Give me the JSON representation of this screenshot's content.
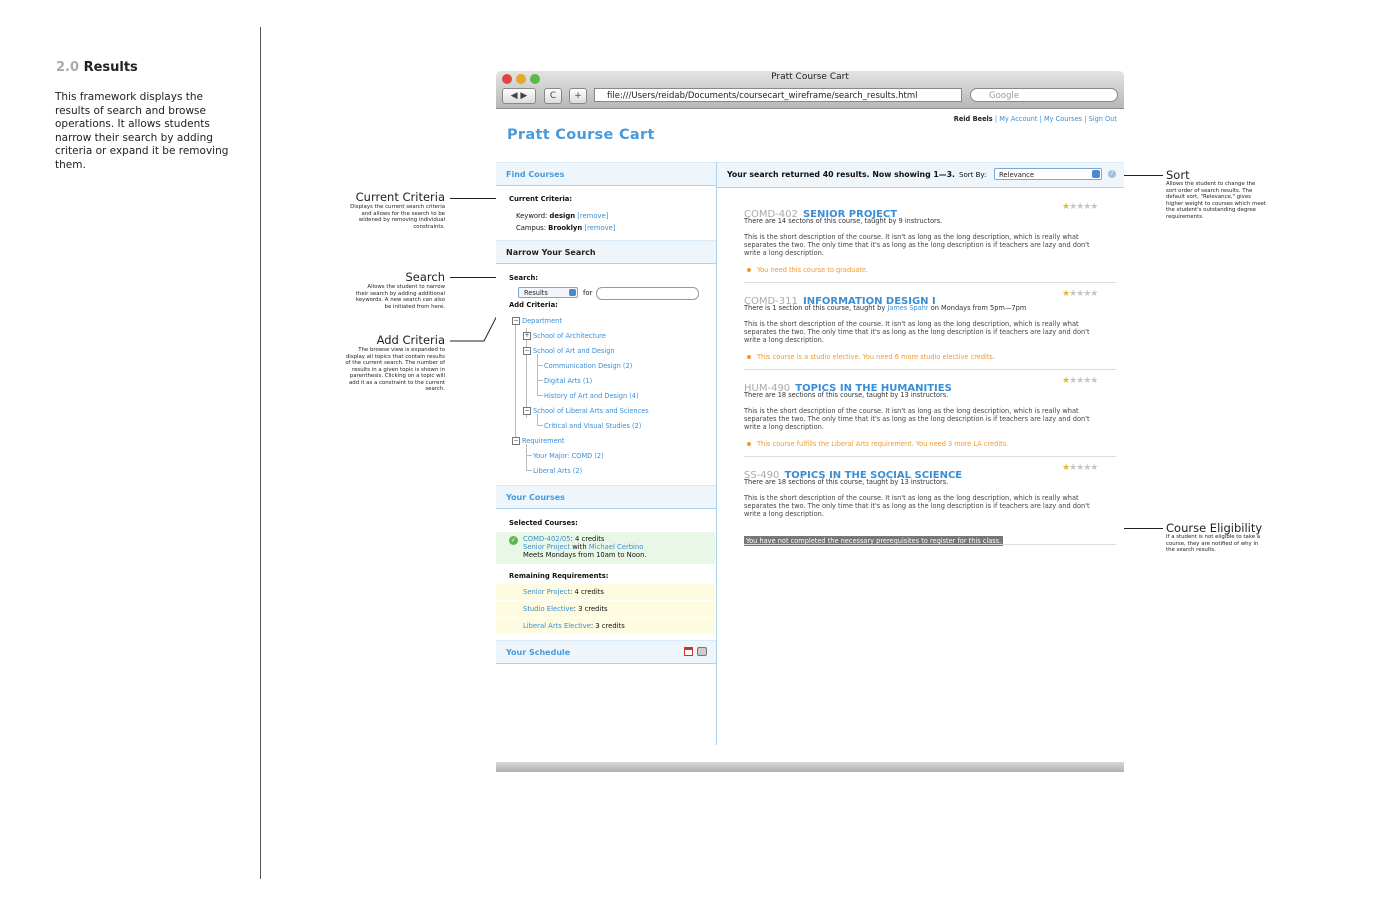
{
  "doc": {
    "section_number": "2.0",
    "section_title": "Results",
    "description": "This framework displays the results of search and browse operations. It allows students narrow their search by adding criteria or expand it be removing them."
  },
  "annotations": {
    "current_criteria": {
      "title": "Current Criteria",
      "body": "Displays the current search criteria and allows for the search to be widened by removing individual constraints."
    },
    "search": {
      "title": "Search",
      "body": "Allows the student to narrow their search by adding additional keywords. A new search can also be initiated from here."
    },
    "add_criteria": {
      "title": "Add Criteria",
      "body": "The browse view is expanded to display all topics that contain results of the current search. The number of results in a given topic is shown in parenthesis. Clicking on a topic will add it as a constraint to the current search."
    },
    "sort": {
      "title": "Sort",
      "body": "Allows the student to change the sort order of search results. The default sort, \"Relevance,\" gives higher weight to courses which meet the student's outstanding degree requirements."
    },
    "eligibility": {
      "title": "Course Eligibility",
      "body": "If a student is not eligible to take a course, they are notified of why in the search results."
    }
  },
  "browser": {
    "window_title": "Pratt Course Cart",
    "url": "file:///Users/reidab/Documents/coursecart_wireframe/search_results.html",
    "search_placeholder": "Google",
    "back_label": "◀ ▶",
    "reload_label": "C",
    "add_label": "+"
  },
  "app": {
    "brand": "Pratt Course Cart",
    "user_name": "Reid Beels",
    "links": {
      "my_account": "My Account",
      "my_courses": "My Courses",
      "sign_out": "Sign Out"
    },
    "separator": "|"
  },
  "sidebar": {
    "find_courses": "Find Courses",
    "current_criteria_label": "Current Criteria:",
    "criteria": [
      {
        "label": "Keyword:",
        "value": "design",
        "remove": "[remove]"
      },
      {
        "label": "Campus:",
        "value": "Brooklyn",
        "remove": "[remove]"
      }
    ],
    "narrow_head": "Narrow Your Search",
    "search_label": "Search:",
    "search_scope": "Results",
    "search_for": "for",
    "add_criteria_label": "Add Criteria:",
    "tree": {
      "department": "Department",
      "architecture": "School of Architecture",
      "art_design": "School of Art and Design",
      "comm_design": "Communication Design (2)",
      "digital_arts": "Digital Arts (1)",
      "history": "History of Art and Design (4)",
      "liberal_arts": "School of Liberal Arts and Sciences",
      "critical": "Critical and Visual Studies (2)",
      "requirement": "Requirement",
      "your_major": "Your Major: COMD (2)",
      "lib_arts_req": "Liberal Arts (2)"
    },
    "your_courses": "Your Courses",
    "selected_label": "Selected Courses:",
    "selected": {
      "code": "COMD-402/05",
      "credits": ": 4 credits",
      "title": "Senior Project",
      "with": "with",
      "instructor": "Michael Cerbino",
      "meets": "Meets Mondays from 10am to Noon."
    },
    "remaining_label": "Remaining Requirements:",
    "remaining": [
      {
        "name": "Senior Project",
        "credits": ": 4 credits"
      },
      {
        "name": "Studio Elective",
        "credits": ": 3 credits"
      },
      {
        "name": "Liberal Arts Elective",
        "credits": ": 3 credits"
      }
    ],
    "your_schedule": "Your Schedule"
  },
  "results": {
    "summary": "Your search returned 40 results. Now showing 1—3.",
    "sort_label": "Sort By:",
    "sort_value": "Relevance",
    "help": "?",
    "courses": [
      {
        "code": "COMD-402",
        "title": "SENIOR PROJECT",
        "meta": "There are 14 sectons of this course, taught by 9 instructors.",
        "desc": "This is the short description of the course. It isn't as long as the long description, which is really what separates the two. The only time that it's as long as the long description is if teachers are lazy and don't write a long description.",
        "note": "You need this course to graduate.",
        "rating": 1
      },
      {
        "code": "COMD-311",
        "title": "INFORMATION DESIGN I",
        "meta_pre": "There is 1 section of this course, taught by ",
        "meta_link": "James Spahr",
        "meta_post": " on Mondays from 5pm—7pm",
        "desc": "This is the short description of the course. It isn't as long as the long description, which is really what separates the two. The only time that it's as long as the long description is if teachers are lazy and don't write a long description.",
        "note": "This course is a studio elective. You need 6 more studio elective credits.",
        "rating": 1
      },
      {
        "code": "HUM-490",
        "title": "TOPICS IN THE HUMANITIES",
        "meta": "There are 18 sections of this course, taught by 13 instructors.",
        "desc": "This is the short description of the course. It isn't as long as the long description, which is really what separates the two. The only time that it's as long as the long description is if teachers are lazy and don't write a long description.",
        "note": "This course fulfills the Liberal Arts requirement. You need 3 more LA credits.",
        "rating": 1
      },
      {
        "code": "SS-490",
        "title": "TOPICS IN THE SOCIAL SCIENCE",
        "meta": "There are 18 sections of this course, taught by 13 instructors.",
        "desc": "This is the short description of the course. It isn't as long as the long description, which is really what separates the two. The only time that it's as long as the long description is if teachers are lazy and don't write a long description.",
        "warning": "You have not completed the necessary prerequisites to register for this class.",
        "rating": 1
      }
    ]
  },
  "colors": {
    "accent": "#4a9ad9",
    "link": "#3a8ed6",
    "note": "#f09a2a",
    "panel": "#eef6fc",
    "requirement_bg": "#fdfbe0",
    "selected_bg": "#e9f7e6"
  }
}
